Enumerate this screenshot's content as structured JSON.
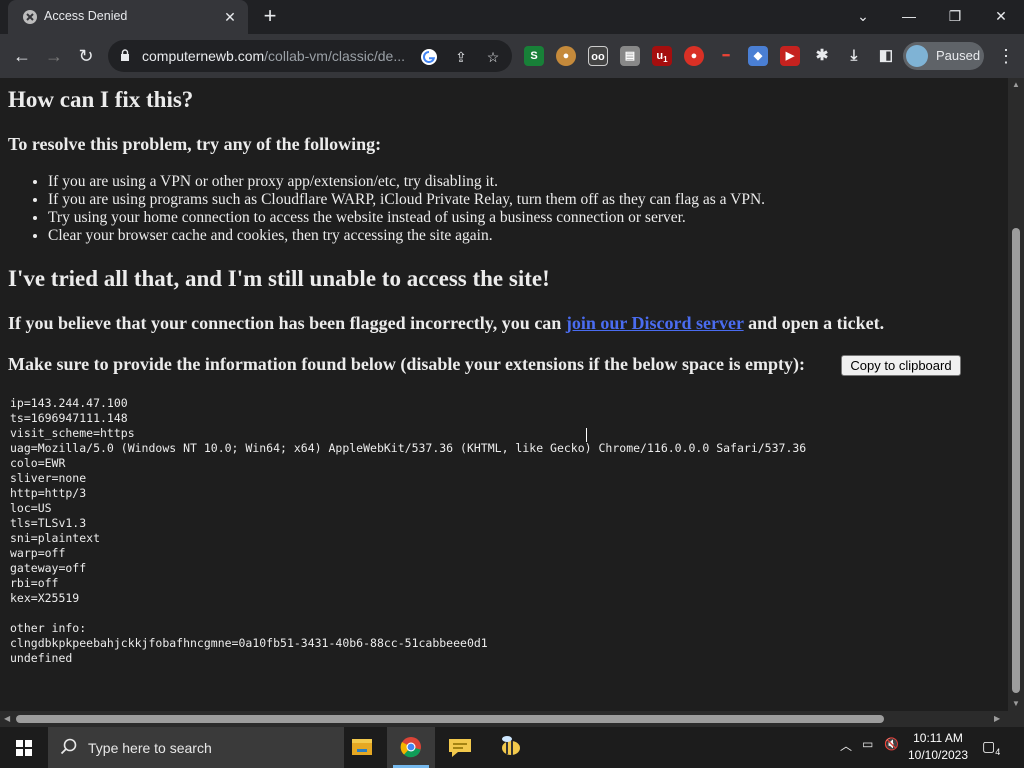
{
  "browser": {
    "tab_title": "Access Denied",
    "new_tab_label": "+",
    "url_host": "computernewb.com",
    "url_path": "/collab-vm/classic/de...",
    "profile_label": "Paused",
    "extension_badge": "1"
  },
  "page": {
    "heading_fix": "How can I fix this?",
    "subheading_resolve": "To resolve this problem, try any of the following:",
    "fixes": [
      "If you are using a VPN or other proxy app/extension/etc, try disabling it.",
      "If you are using programs such as Cloudflare WARP, iCloud Private Relay, turn them off as they can flag as a VPN.",
      "Try using your home connection to access the website instead of using a business connection or server.",
      "Clear your browser cache and cookies, then try accessing the site again."
    ],
    "heading_still": "I've tried all that, and I'm still unable to access the site!",
    "flagged_prefix": "If you believe that your connection has been flagged incorrectly, you can ",
    "flagged_link": "join our Discord server",
    "flagged_suffix": " and open a ticket.",
    "provide_text": "Make sure to provide the information found below (disable your extensions if the below space is empty):",
    "copy_button": "Copy to clipboard",
    "info_block": "ip=143.244.47.100\nts=1696947111.148\nvisit_scheme=https\nuag=Mozilla/5.0 (Windows NT 10.0; Win64; x64) AppleWebKit/537.36 (KHTML, like Gecko) Chrome/116.0.0.0 Safari/537.36\ncolo=EWR\nsliver=none\nhttp=http/3\nloc=US\ntls=TLSv1.3\nsni=plaintext\nwarp=off\ngateway=off\nrbi=off\nkex=X25519\n\nother info:\nclngdbkpkpeebahjckkjfobafhncgmne=0a10fb51-3431-40b6-88cc-51cabbeee0d1\nundefined"
  },
  "taskbar": {
    "search_placeholder": "Type here to search",
    "time": "10:11 AM",
    "date": "10/10/2023",
    "notification_count": "4"
  },
  "colors": {
    "tab_bg": "#35363a",
    "page_bg": "#1e1e1e",
    "link": "#4a6cf0"
  }
}
